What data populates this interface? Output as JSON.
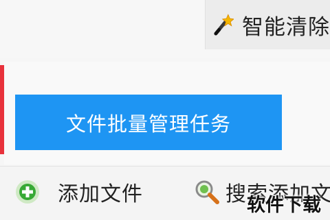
{
  "toolbar": {
    "clean_label": "智能清除",
    "clean_icon": "magic-wand-icon"
  },
  "main": {
    "primary_label": "文件批量管理任务",
    "primary_color": "#1e95f3",
    "accent_edge_color": "#e8323c"
  },
  "actions": {
    "add_label": "添加文件",
    "add_icon": "plus-circle-icon",
    "search_label": "搜索添加文",
    "search_icon": "search-icon"
  },
  "watermark": {
    "text": "软件下载"
  }
}
